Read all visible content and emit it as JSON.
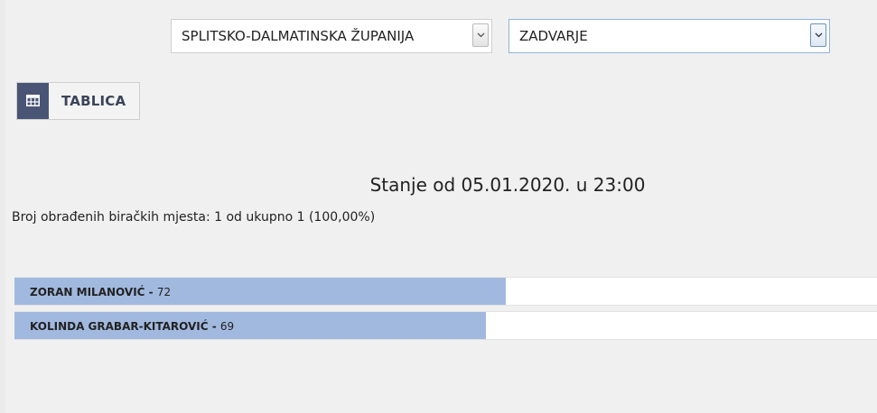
{
  "filters": {
    "county": "SPLITSKO-DALMATINSKA ŽUPANIJA",
    "municipality": "ZADVARJE"
  },
  "view_toggle": {
    "icon": "table-grid-icon",
    "label": "TABLICA",
    "icon_bg": "#4a5475"
  },
  "status_text": "Stanje od 05.01.2020. u 23:00",
  "processed_text": "Broj obrađenih biračkih mjesta: 1 od ukupno 1 (100,00%)",
  "bar_color": "#a2b9df",
  "results": [
    {
      "name": "ZORAN MILANOVIĆ",
      "separator": " - ",
      "votes": "72",
      "share": 0.57
    },
    {
      "name": "KOLINDA GRABAR-KITAROVIĆ",
      "separator": " - ",
      "votes": "69",
      "share": 0.547
    }
  ]
}
